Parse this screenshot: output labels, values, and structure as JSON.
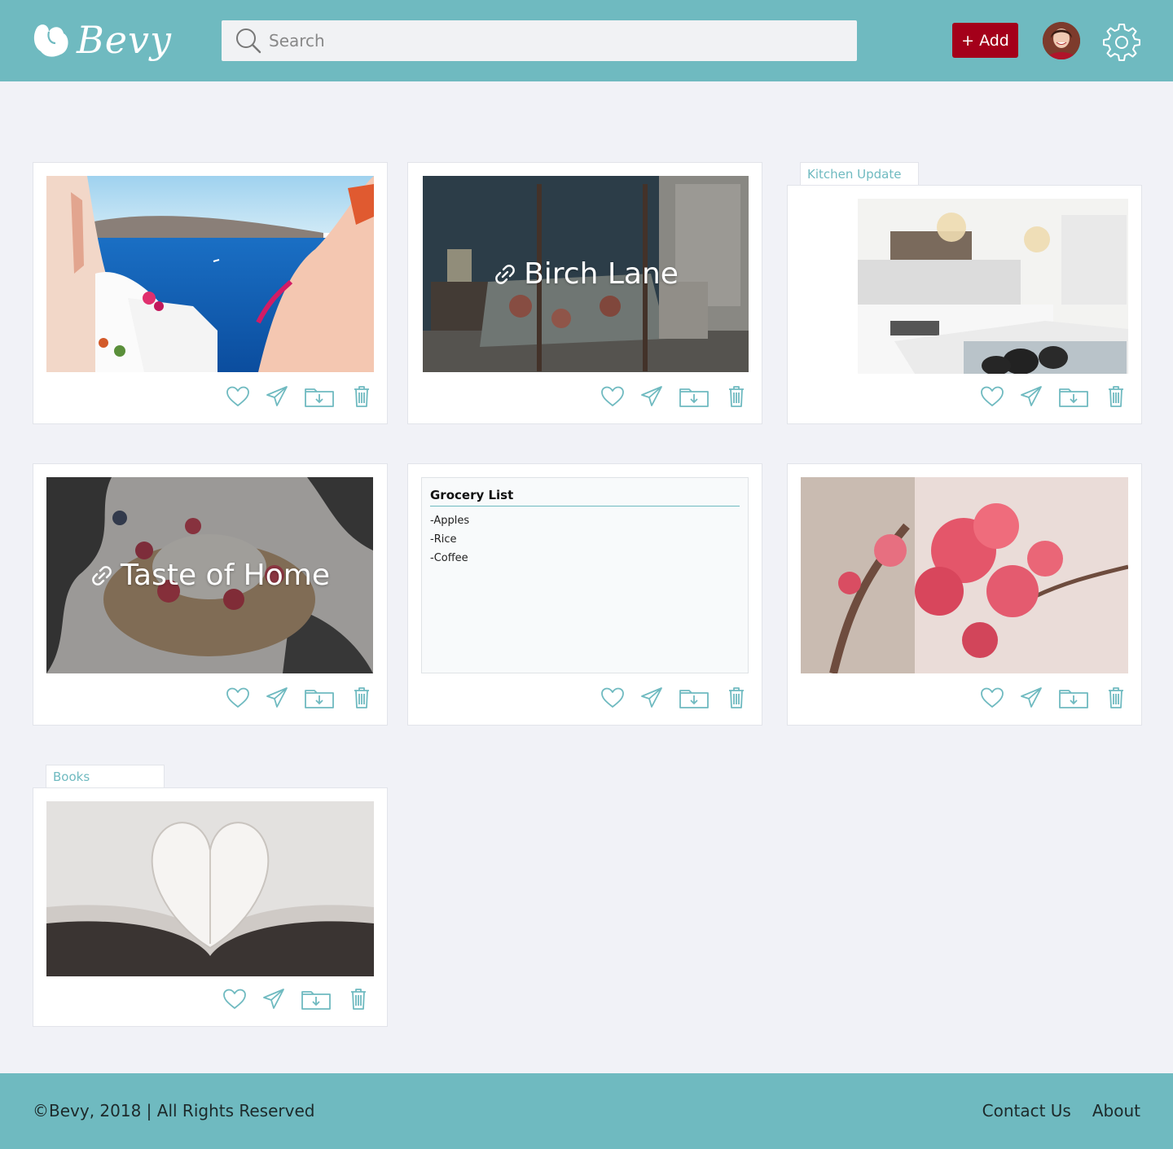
{
  "header": {
    "logo_text": "Bevy",
    "search_placeholder": "Search",
    "add_label": "+ Add"
  },
  "cards": [
    {
      "kind": "image",
      "scene": "Seaside cliffs with white buildings overlooking blue sea"
    },
    {
      "kind": "link",
      "title": "Birch Lane"
    },
    {
      "kind": "image",
      "tab": "Kitchen Update"
    },
    {
      "kind": "link",
      "title": "Taste of Home"
    },
    {
      "kind": "note",
      "title": "Grocery List",
      "items": [
        "-Apples",
        "-Rice",
        "-Coffee"
      ]
    },
    {
      "kind": "image"
    },
    {
      "kind": "image",
      "tab": "Books"
    }
  ],
  "footer": {
    "copyright": "©Bevy, 2018 | All Rights Reserved",
    "contact": "Contact Us",
    "about": "About"
  },
  "colors": {
    "accent": "#6fbac0",
    "add_button": "#a4001a",
    "page_bg": "#f1f2f7"
  },
  "icons": [
    "heart-icon",
    "send-icon",
    "folder-download-icon",
    "trash-icon",
    "link-icon",
    "search-icon",
    "gear-icon"
  ]
}
